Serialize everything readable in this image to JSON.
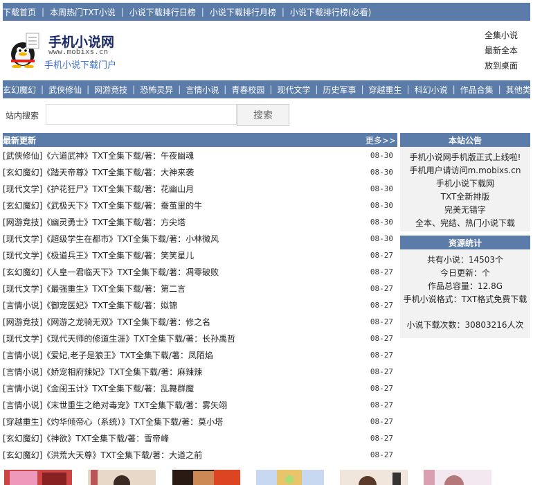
{
  "topnav": [
    "下载首页",
    "本周热门TXT小说",
    "小说下载排行日榜",
    "小说下载排行月榜",
    "小说下载排行榜(必看)"
  ],
  "header": {
    "logo_title": "手机小说网",
    "logo_url": "www.mobixs.cn",
    "logo_sub": "手机小说下载门户",
    "links": [
      "全集小说",
      "最新全本",
      "放到桌面"
    ]
  },
  "catnav": [
    "玄幻魔幻",
    "武侠修仙",
    "网游竞技",
    "恐怖灵异",
    "言情小说",
    "青春校园",
    "现代文学",
    "历史军事",
    "穿越重生",
    "科幻小说",
    "作品合集",
    "其他类"
  ],
  "search": {
    "label": "站内搜索",
    "value": "",
    "button": "搜索"
  },
  "latest": {
    "title": "最新更新",
    "more": "更多>>",
    "items": [
      {
        "cat": "[武侠修仙]",
        "text": "《六道武神》TXT全集下载/著：午夜幽魂",
        "date": "08-30"
      },
      {
        "cat": "[玄幻魔幻]",
        "text": "《踏天帝尊》TXT全集下载/著：大神来袭",
        "date": "08-30"
      },
      {
        "cat": "[现代文学]",
        "text": "《护花狂尸》TXT全集下载/著：花幽山月",
        "date": "08-30"
      },
      {
        "cat": "[玄幻魔幻]",
        "text": "《武极天下》TXT全集下载/著：蚕茧里的牛",
        "date": "08-30"
      },
      {
        "cat": "[网游竞技]",
        "text": "《幽灵勇士》TXT全集下载/著：方尖塔",
        "date": "08-30"
      },
      {
        "cat": "[现代文学]",
        "text": "《超级学生在都市》TXT全集下载/著：小林微风",
        "date": "08-30"
      },
      {
        "cat": "[现代文学]",
        "text": "《极道兵王》TXT全集下载/著：笑笑星儿",
        "date": "08-27"
      },
      {
        "cat": "[玄幻魔幻]",
        "text": "《人皇一君临天下》TXT全集下载/著：凋零破败",
        "date": "08-27"
      },
      {
        "cat": "[现代文学]",
        "text": "《最强重生》TXT全集下载/著：第二言",
        "date": "08-27"
      },
      {
        "cat": "[言情小说]",
        "text": "《御宠医妃》TXT全集下载/著：姒锦",
        "date": "08-27"
      },
      {
        "cat": "[网游竞技]",
        "text": "《网游之龙骑无双》TXT全集下载/著：修之名",
        "date": "08-27"
      },
      {
        "cat": "[现代文学]",
        "text": "《现代天师的修道生涯》TXT全集下载/著：长孙禹哲",
        "date": "08-27"
      },
      {
        "cat": "[言情小说]",
        "text": "《爱妃,老子是狼王》TXT全集下载/著：凤陌焰",
        "date": "08-27"
      },
      {
        "cat": "[言情小说]",
        "text": "《娇宠相府辣妃》TXT全集下载/著：麻辣辣",
        "date": "08-27"
      },
      {
        "cat": "[言情小说]",
        "text": "《金闺玉计》TXT全集下载/著：乱舞群魔",
        "date": "08-27"
      },
      {
        "cat": "[言情小说]",
        "text": "《末世重生之绝对毒宠》TXT全集下载/著：雾矢翊",
        "date": "08-27"
      },
      {
        "cat": "[穿越重生]",
        "text": "《灼华倾帝心（系统）》TXT全集下载/著：莫小塔",
        "date": "08-27"
      },
      {
        "cat": "[玄幻魔幻]",
        "text": "《神欲》TXT全集下载/著：雪帝峰",
        "date": "08-27"
      },
      {
        "cat": "[玄幻魔幻]",
        "text": "《洪荒大天尊》TXT全集下载/著：大道之前",
        "date": "08-27"
      }
    ]
  },
  "notice": {
    "title": "本站公告",
    "lines": [
      "手机小说网手机版正式上线啦!",
      "手机用户请访问m.mobixs.cn",
      "手机小说下载网",
      "TXT全新排版",
      "完美无错字",
      "全本、完结、热门小说下载"
    ]
  },
  "stats": {
    "title": "资源统计",
    "lines": [
      "共有小说：14503个",
      "今日更新：个",
      "作品总容量：12.8G",
      "手机小说格式：TXT格式免费下载"
    ],
    "downloads": "小说下载次数：30803216人次"
  },
  "colors": {
    "bar": "#5b7ba8",
    "sidebar_bg": "#f2f2f2",
    "logo_sub": "#3a6fd0"
  }
}
